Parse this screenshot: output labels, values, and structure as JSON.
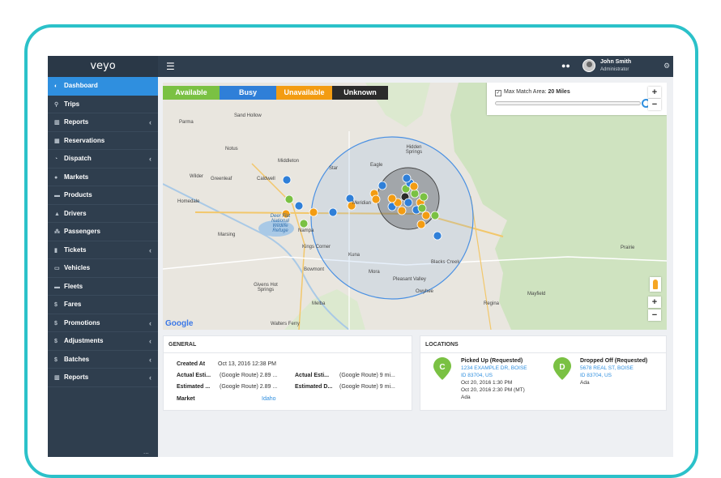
{
  "app": {
    "logo": "veyo",
    "user_name": "John Smith",
    "user_role": "Administrator"
  },
  "sidebar": {
    "items": [
      {
        "label": "Dashboard",
        "icon": "dashboard-icon",
        "glyph": "◐",
        "active": true,
        "chevron": false
      },
      {
        "label": "Trips",
        "icon": "map-pin-icon",
        "glyph": "⚲",
        "active": false,
        "chevron": false
      },
      {
        "label": "Reports",
        "icon": "bar-chart-icon",
        "glyph": "▥",
        "active": false,
        "chevron": true
      },
      {
        "label": "Reservations",
        "icon": "calendar-icon",
        "glyph": "▦",
        "active": false,
        "chevron": false
      },
      {
        "label": "Dispatch",
        "icon": "signal-icon",
        "glyph": "◔",
        "active": false,
        "chevron": true
      },
      {
        "label": "Markets",
        "icon": "globe-icon",
        "glyph": "●",
        "active": false,
        "chevron": false
      },
      {
        "label": "Products",
        "icon": "truck-icon",
        "glyph": "▬",
        "active": false,
        "chevron": false
      },
      {
        "label": "Drivers",
        "icon": "user-icon",
        "glyph": "▲",
        "active": false,
        "chevron": false
      },
      {
        "label": "Passengers",
        "icon": "users-icon",
        "glyph": "⁂",
        "active": false,
        "chevron": false
      },
      {
        "label": "Tickets",
        "icon": "ticket-icon",
        "glyph": "▮",
        "active": false,
        "chevron": true
      },
      {
        "label": "Vehicles",
        "icon": "car-icon",
        "glyph": "▭",
        "active": false,
        "chevron": false
      },
      {
        "label": "Fleets",
        "icon": "truck-icon",
        "glyph": "▬",
        "active": false,
        "chevron": false
      },
      {
        "label": "Fares",
        "icon": "dollar-icon",
        "glyph": "$",
        "active": false,
        "chevron": false
      },
      {
        "label": "Promotions",
        "icon": "dollar-icon",
        "glyph": "$",
        "active": false,
        "chevron": true
      },
      {
        "label": "Adjustments",
        "icon": "dollar-icon",
        "glyph": "$",
        "active": false,
        "chevron": true
      },
      {
        "label": "Batches",
        "icon": "dollar-icon",
        "glyph": "$",
        "active": false,
        "chevron": true
      },
      {
        "label": "Reports",
        "icon": "bar-chart-icon",
        "glyph": "▥",
        "active": false,
        "chevron": true
      }
    ],
    "more": "..."
  },
  "statuses": [
    {
      "label": "Available",
      "color": "#7ac143"
    },
    {
      "label": "Busy",
      "color": "#2f7fd8"
    },
    {
      "label": "Unavailable",
      "color": "#f39c12"
    },
    {
      "label": "Unknown",
      "color": "#2b2b2b"
    }
  ],
  "map": {
    "match_area_label": "Max Match Area:",
    "match_area_value": "20 Miles",
    "zoom_in": "+",
    "zoom_out": "−",
    "google": "Google",
    "places": [
      {
        "name": "Parma"
      },
      {
        "name": "Sand Hollow"
      },
      {
        "name": "Notus"
      },
      {
        "name": "Middleton"
      },
      {
        "name": "Star"
      },
      {
        "name": "Hidden Springs"
      },
      {
        "name": "Eagle"
      },
      {
        "name": "Wilder"
      },
      {
        "name": "Greenleaf"
      },
      {
        "name": "Caldwell"
      },
      {
        "name": "Homedale"
      },
      {
        "name": "Meridian"
      },
      {
        "name": "Deer Flat National Wildlife Refuge"
      },
      {
        "name": "Nampa"
      },
      {
        "name": "Marsing"
      },
      {
        "name": "Kings Corner"
      },
      {
        "name": "Kuna"
      },
      {
        "name": "Blacks Creek"
      },
      {
        "name": "Bowmont"
      },
      {
        "name": "Mora"
      },
      {
        "name": "Pleasant Valley"
      },
      {
        "name": "Givens Hot Springs"
      },
      {
        "name": "Owyhee"
      },
      {
        "name": "Mayfield"
      },
      {
        "name": "Prairie"
      },
      {
        "name": "Regina"
      },
      {
        "name": "Melba"
      },
      {
        "name": "Walters Ferry"
      }
    ]
  },
  "general": {
    "title": "GENERAL",
    "fields": [
      {
        "label": "Created At",
        "value": "Oct 13, 2016 12:38 PM"
      },
      {
        "label": "Actual Esti...",
        "value": "(Google Route) 2.89 ..."
      },
      {
        "label": "Estimated ...",
        "value": "(Google Route) 2.89 ..."
      },
      {
        "label": "Market",
        "value": "Idaho"
      },
      {
        "label": "Actual Esti...",
        "value": "(Google Route) 9 mi..."
      },
      {
        "label": "Estimated D...",
        "value": "(Google Route) 9 mi..."
      }
    ]
  },
  "locations": {
    "title": "LOCATIONS",
    "items": [
      {
        "letter": "C",
        "title": "Picked Up (Requested)",
        "address1": "1234 EXAMPLE DR, BOISE",
        "address2": "ID 83704, US",
        "line1": "Oct 20, 2016 1:30 PM",
        "line2": "Oct 20, 2016 2:30 PM (MT)",
        "line3": "Ada"
      },
      {
        "letter": "D",
        "title": "Dropped Off (Requested)",
        "address1": "5678 REAL ST, BOISE",
        "address2": "ID 83704, US",
        "line1": "Ada"
      }
    ],
    "pin_color": "#7ac143"
  }
}
